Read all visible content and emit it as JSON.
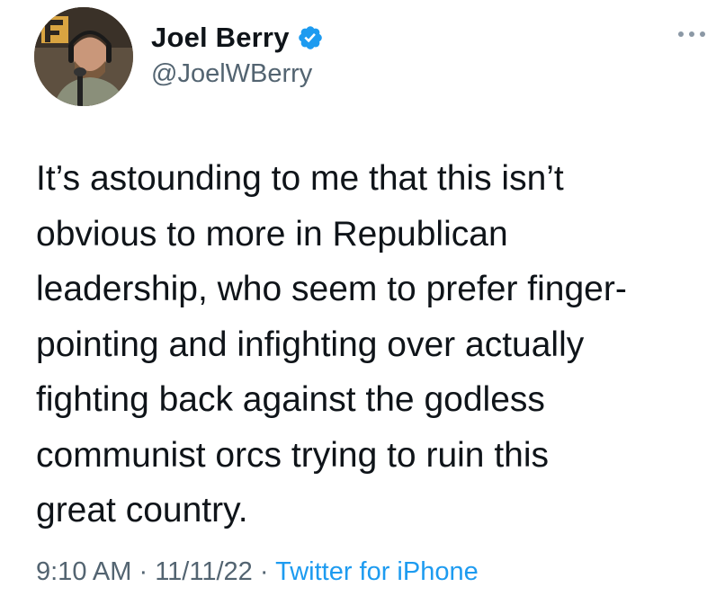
{
  "author": {
    "display_name": "Joel Berry",
    "handle": "@JoelWBerry",
    "verified": true,
    "avatar_icon": "profile-photo"
  },
  "tweet": {
    "lines": [
      "It’s astounding to me that this isn’t",
      "obvious to more in Republican",
      "leadership, who seem to prefer finger-",
      "pointing and infighting over actually",
      "fighting back against the godless",
      "communist orcs trying to ruin this",
      "great country."
    ]
  },
  "meta": {
    "time": "9:10 AM",
    "separator": "·",
    "date": "11/11/22",
    "source": "Twitter for iPhone"
  },
  "colors": {
    "text": "#0f1419",
    "secondary": "#536471",
    "accent": "#1d9bf0",
    "background": "#ffffff"
  },
  "icons": {
    "verified": "verified-badge-icon",
    "more": "more-options-icon"
  }
}
